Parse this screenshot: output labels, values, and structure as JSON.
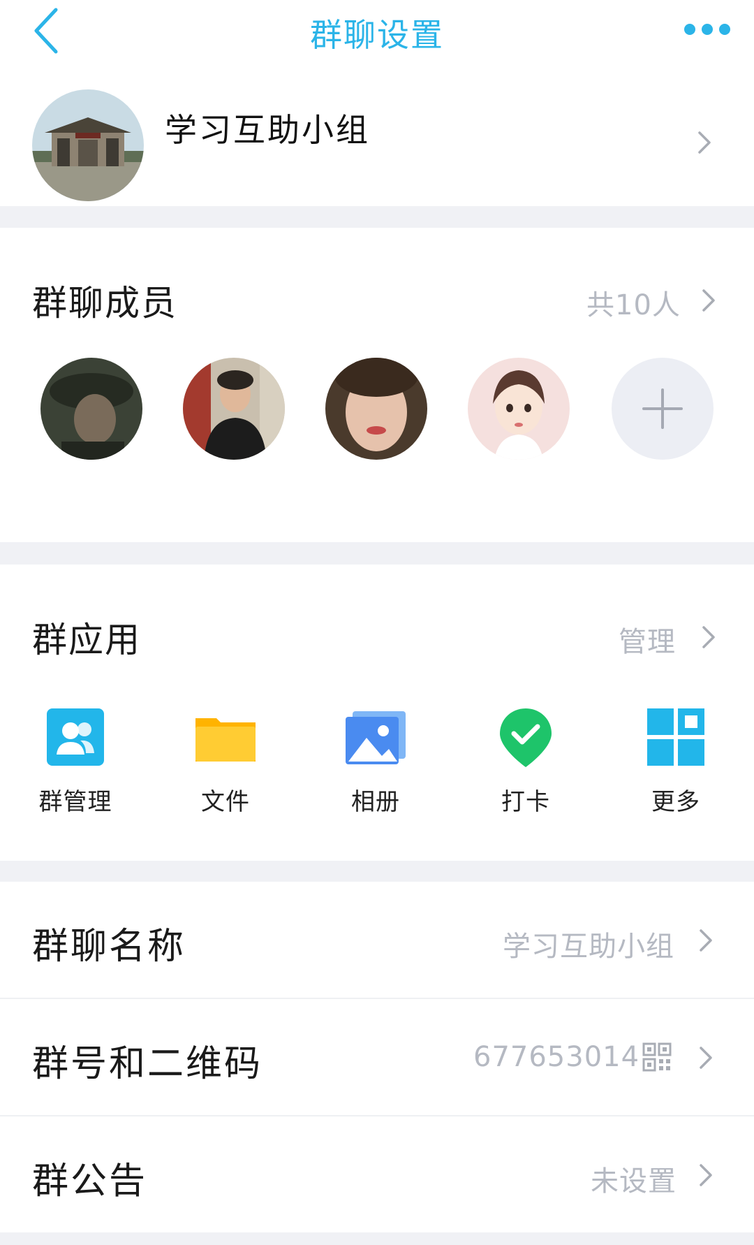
{
  "navbar": {
    "title": "群聊设置",
    "back_icon": "chevron-left-icon",
    "more_icon": "more-dots-icon",
    "accent_color": "#2bb4e8"
  },
  "group": {
    "name": "学习互助小组",
    "avatar_icon": "group-avatar-gate-image"
  },
  "members": {
    "title": "群聊成员",
    "count_label": "共10人",
    "add_icon": "plus-icon"
  },
  "apps": {
    "title": "群应用",
    "manage_label": "管理",
    "items": [
      {
        "label": "群管理",
        "icon": "group-manage-icon",
        "color": "#22b6ea"
      },
      {
        "label": "文件",
        "icon": "folder-icon",
        "color": "#ffc21a"
      },
      {
        "label": "相册",
        "icon": "photo-album-icon",
        "color": "#4a8bf0"
      },
      {
        "label": "打卡",
        "icon": "check-in-icon",
        "color": "#1ec46a"
      },
      {
        "label": "更多",
        "icon": "more-grid-icon",
        "color": "#22b6ea"
      }
    ]
  },
  "rows": {
    "name": {
      "title": "群聊名称",
      "value": "学习互助小组"
    },
    "number": {
      "title": "群号和二维码",
      "value": "677653014",
      "icon": "qr-code-icon"
    },
    "notice": {
      "title": "群公告",
      "value": "未设置"
    }
  }
}
